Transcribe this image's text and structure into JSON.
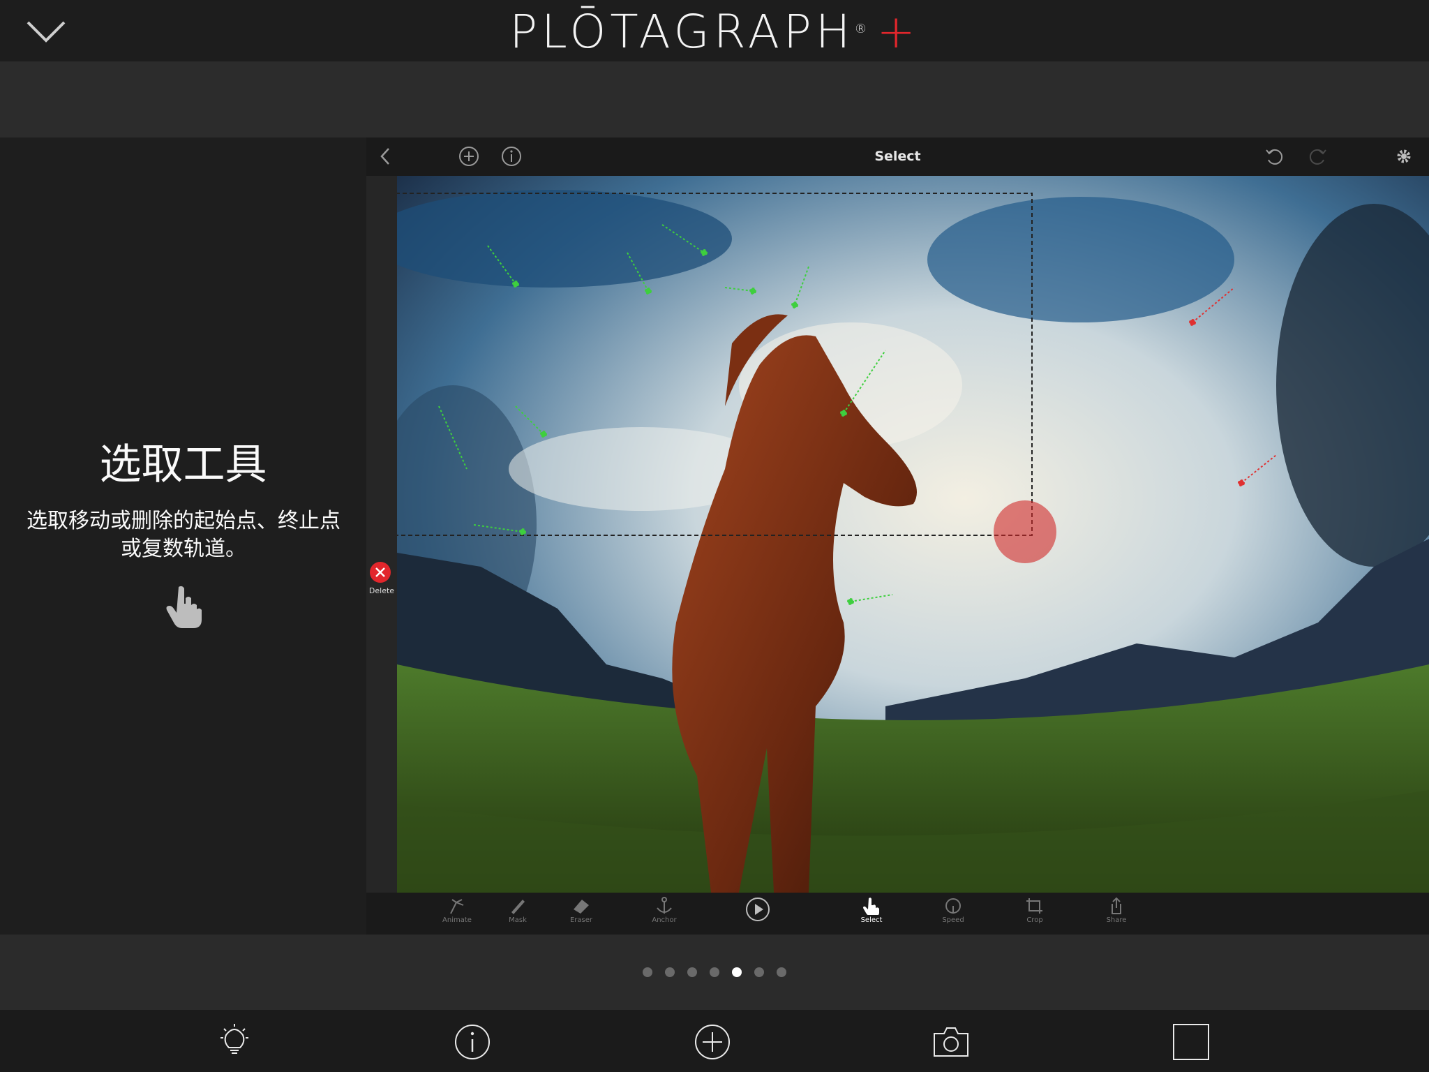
{
  "app": {
    "logo_text": "PLŌTAGRAPH",
    "logo_reg": "®",
    "logo_plus": "+",
    "accent_color": "#e2262c"
  },
  "tutorial": {
    "title": "选取工具",
    "description": "选取移动或删除的起始点、终止点或复数轨道。",
    "icon": "hand-pointer-icon"
  },
  "device": {
    "screen_title": "Select",
    "top_icons": [
      "back-icon",
      "add-icon",
      "info-icon",
      "undo-icon",
      "redo-icon",
      "settings-icon"
    ],
    "delete_label": "Delete",
    "tools": [
      {
        "label": "Animate",
        "icon": "animate-icon",
        "active": false
      },
      {
        "label": "Mask",
        "icon": "brush-icon",
        "active": false
      },
      {
        "label": "Eraser",
        "icon": "eraser-icon",
        "active": false
      },
      {
        "label": "Anchor",
        "icon": "anchor-icon",
        "active": false
      },
      {
        "label": "",
        "icon": "play-icon",
        "active": false
      },
      {
        "label": "Select",
        "icon": "hand-pointer-icon",
        "active": true
      },
      {
        "label": "Speed",
        "icon": "speed-icon",
        "active": false
      },
      {
        "label": "Crop",
        "icon": "crop-icon",
        "active": false
      },
      {
        "label": "Share",
        "icon": "share-icon",
        "active": false
      }
    ]
  },
  "pager": {
    "total": 7,
    "active_index": 4
  },
  "tabbar": {
    "items": [
      "lightbulb-icon",
      "info-icon",
      "add-icon",
      "camera-icon",
      "square-icon"
    ]
  }
}
